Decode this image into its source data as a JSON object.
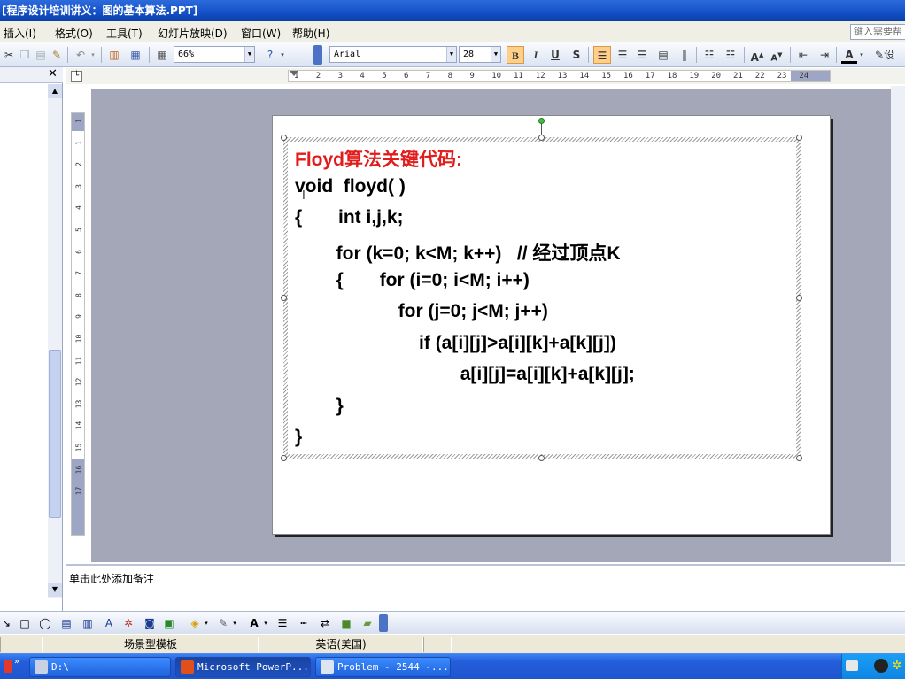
{
  "window": {
    "title": "[程序设计培训讲义：图的基本算法.PPT]"
  },
  "menu": {
    "items": [
      "插入(I)",
      "格式(O)",
      "工具(T)",
      "幻灯片放映(D)",
      "窗口(W)",
      "帮助(H)"
    ],
    "help_placeholder": "键入需要帮"
  },
  "toolbar": {
    "zoom": "66%",
    "font_name": "Arial",
    "font_size": "28",
    "bold_label": "B",
    "italic_label": "I",
    "underline_label": "U",
    "shadow_label": "S",
    "design_label": "设"
  },
  "ruler": {
    "h_ticks": [
      "1",
      "2",
      "3",
      "4",
      "5",
      "6",
      "7",
      "8",
      "9",
      "10",
      "11",
      "12",
      "13",
      "14",
      "15",
      "16",
      "17",
      "18",
      "19",
      "20",
      "21",
      "22",
      "23",
      "24"
    ],
    "v_ticks": [
      "1",
      "1",
      "2",
      "3",
      "4",
      "5",
      "6",
      "7",
      "8",
      "9",
      "10",
      "11",
      "12",
      "13",
      "14",
      "15",
      "16",
      "17"
    ]
  },
  "slide": {
    "title": "Floyd算法关键代码:",
    "code_lines": [
      "void  floyd( )",
      "{       int i,j,k;",
      "        for (k=0; k<M; k++)   // 经过顶点K",
      "        {       for (i=0; i<M; i++)",
      "                    for (j=0; j<M; j++)",
      "                        if (a[i][j]>a[i][k]+a[k][j])",
      "                                a[i][j]=a[i][k]+a[k][j];",
      "        }",
      "}"
    ]
  },
  "notes": {
    "placeholder": "单击此处添加备注"
  },
  "status": {
    "design": "场景型模板",
    "language": "英语(美国)"
  },
  "taskbar": {
    "items": [
      "D:\\",
      "Microsoft PowerP...",
      "Problem - 2544 -..."
    ]
  },
  "colors": {
    "title_red": "#e21b1b",
    "titlebar_blue": "#1450c8",
    "taskbar_blue": "#245edb",
    "canvas_gray": "#a3a7b8"
  }
}
